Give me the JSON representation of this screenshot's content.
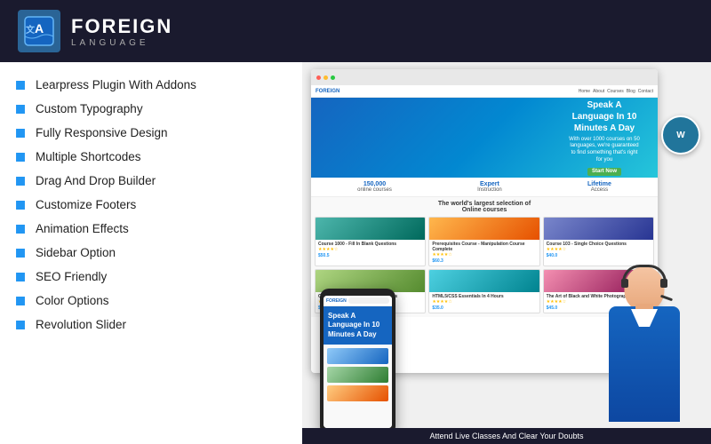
{
  "header": {
    "logo_icon": "A",
    "logo_title": "FOREIGN",
    "logo_subtitle": "LANGUAGE"
  },
  "features": {
    "items": [
      "Learpress Plugin With Addons",
      "Custom Typography",
      "Fully Responsive Design",
      "Multiple Shortcodes",
      "Drag And Drop Builder",
      "Customize Footers",
      "Animation Effects",
      "Sidebar Option",
      "SEO Friendly",
      "Color Options",
      "Revolution Slider"
    ]
  },
  "site_preview": {
    "nav_logo": "FOREIGN",
    "nav_links": [
      "Home",
      "About",
      "Courses",
      "Blog",
      "Contact"
    ],
    "hero_tagline": "Speak A Language In 10 Minutes A Day",
    "hero_sub": "With over 1000 courses on 50 languages, we're guaranteed to find something that's right for you",
    "hero_btn": "Start Now",
    "stats": [
      {
        "num": "150,000",
        "label": "online courses"
      },
      {
        "num": "Expert",
        "label": "Instruction"
      },
      {
        "num": "Lifetime",
        "label": "Access"
      }
    ],
    "courses_title": "The world's largest selection of Online courses",
    "courses": [
      {
        "title": "Course 1000 - Fill In Blank Questions",
        "price": "$50.5",
        "img": "c1"
      },
      {
        "title": "Prerequisites Course - Manipulation Course Complete",
        "price": "$60.3",
        "img": "c2"
      },
      {
        "title": "Course 103 - Single Choice Questions",
        "price": "$40.0",
        "img": "c3"
      },
      {
        "title": "Course 504 - True Or False Questions",
        "price": "$55.0",
        "img": "c4"
      },
      {
        "title": "HTML5/CSS Essentials In 4 Hours",
        "price": "$35.0",
        "img": "c5"
      },
      {
        "title": "The Art of Black and White Photography",
        "price": "$45.0",
        "img": "c6"
      }
    ]
  },
  "phone_preview": {
    "logo": "FOREIGN",
    "hero_text": "Speak A Language In 10 Minutes A Day"
  },
  "wp_badge": "W",
  "bottom_bar": "Attend Live Classes And Clear Your Doubts"
}
